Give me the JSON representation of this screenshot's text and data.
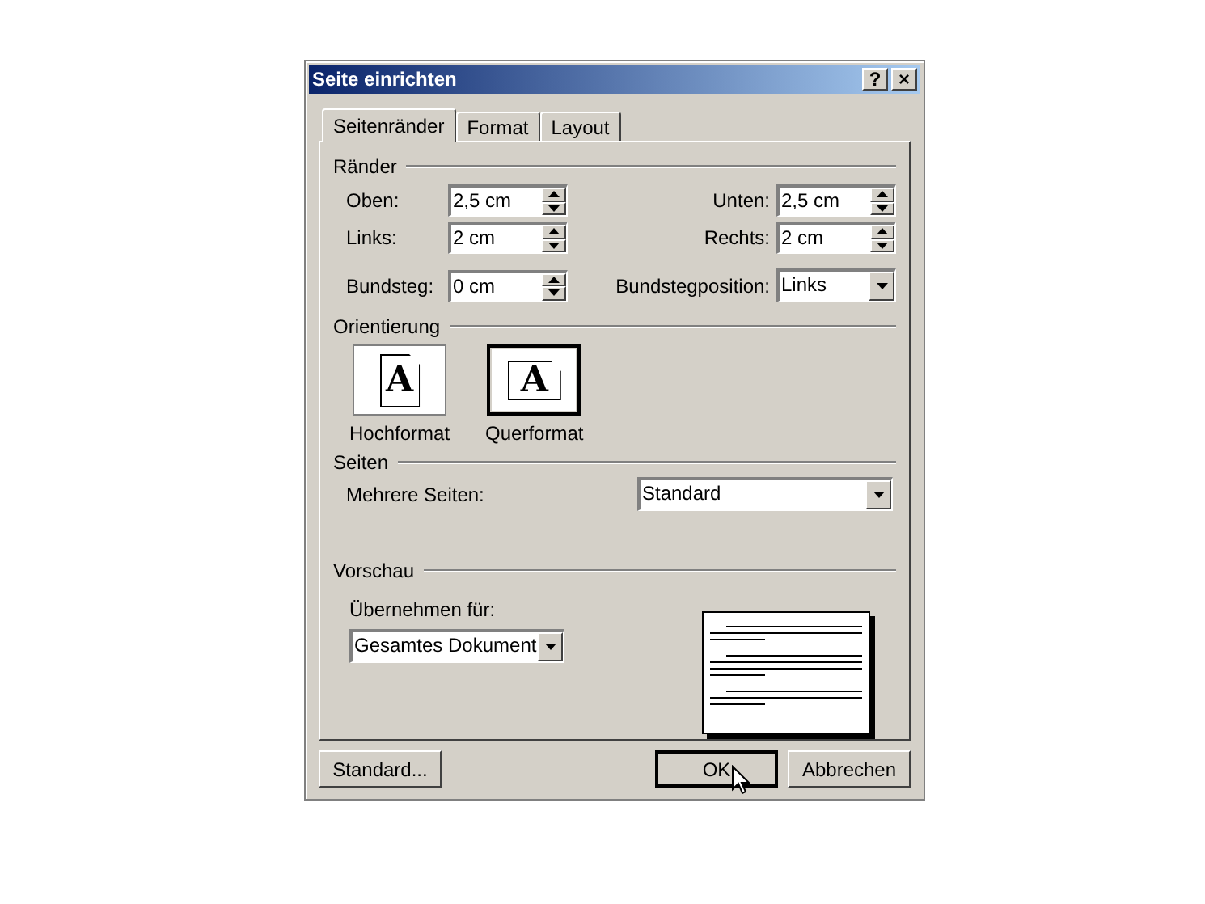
{
  "window": {
    "title": "Seite einrichten",
    "title_buttons": [
      "?",
      "×"
    ]
  },
  "tabs": [
    {
      "label": "Seitenränder",
      "selected": true
    },
    {
      "label": "Format",
      "selected": false
    },
    {
      "label": "Layout",
      "selected": false
    }
  ],
  "margins": {
    "title": "Ränder",
    "rows": [
      [
        {
          "kind": "spin",
          "label": "Oben:",
          "value": "2,5 cm"
        },
        {
          "kind": "spin",
          "label": "Unten:",
          "value": "2,5 cm"
        }
      ],
      [
        {
          "kind": "spin",
          "label": "Links:",
          "value": "2 cm"
        },
        {
          "kind": "spin",
          "label": "Rechts:",
          "value": "2 cm"
        }
      ],
      [
        {
          "kind": "spin",
          "label": "Bundsteg:",
          "value": "0 cm"
        },
        {
          "kind": "dropdown",
          "label": "Bundstegposition:",
          "value": "Links"
        }
      ]
    ]
  },
  "orientation": {
    "title": "Orientierung",
    "options": [
      {
        "kind": "portrait",
        "label": "Hochformat",
        "selected": false,
        "glyph": "A"
      },
      {
        "kind": "landscape",
        "label": "Querformat",
        "selected": true,
        "glyph": "A"
      }
    ]
  },
  "pages": {
    "title": "Seiten",
    "label": "Mehrere Seiten:",
    "value": "Standard"
  },
  "preview": {
    "title": "Vorschau",
    "label": "Übernehmen für:",
    "value": "Gesamtes Dokument"
  },
  "buttons": [
    {
      "label": "Standard...",
      "default": false
    },
    {
      "label": "OK",
      "default": true
    },
    {
      "label": "Abbrechen",
      "default": false
    }
  ]
}
